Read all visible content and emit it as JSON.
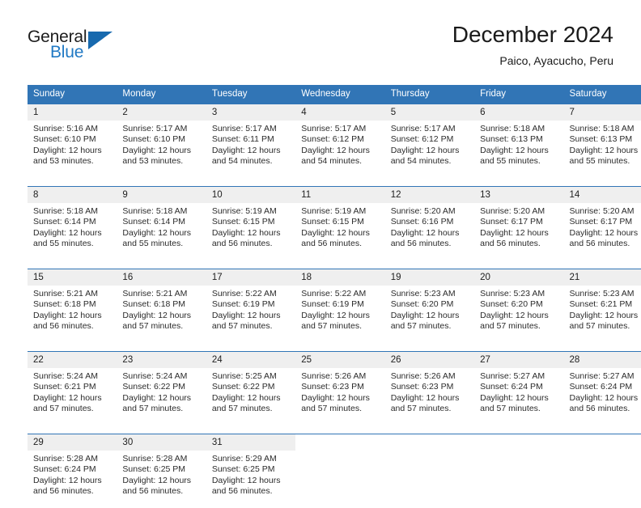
{
  "brand": {
    "name_part1": "General",
    "name_part2": "Blue",
    "triangle_color": "#1769ae",
    "blue_color": "#2079c4"
  },
  "header": {
    "title": "December 2024",
    "subtitle": "Paico, Ayacucho, Peru"
  },
  "theme": {
    "header_blue": "#3175b6",
    "daynum_bg": "#efefef"
  },
  "weekdays": [
    "Sunday",
    "Monday",
    "Tuesday",
    "Wednesday",
    "Thursday",
    "Friday",
    "Saturday"
  ],
  "labels": {
    "sunrise_prefix": "Sunrise:",
    "sunset_prefix": "Sunset:",
    "daylight_prefix": "Daylight:"
  },
  "weeks": [
    [
      {
        "day": "1",
        "sunrise": "Sunrise: 5:16 AM",
        "sunset": "Sunset: 6:10 PM",
        "daylight1": "Daylight: 12 hours",
        "daylight2": "and 53 minutes."
      },
      {
        "day": "2",
        "sunrise": "Sunrise: 5:17 AM",
        "sunset": "Sunset: 6:10 PM",
        "daylight1": "Daylight: 12 hours",
        "daylight2": "and 53 minutes."
      },
      {
        "day": "3",
        "sunrise": "Sunrise: 5:17 AM",
        "sunset": "Sunset: 6:11 PM",
        "daylight1": "Daylight: 12 hours",
        "daylight2": "and 54 minutes."
      },
      {
        "day": "4",
        "sunrise": "Sunrise: 5:17 AM",
        "sunset": "Sunset: 6:12 PM",
        "daylight1": "Daylight: 12 hours",
        "daylight2": "and 54 minutes."
      },
      {
        "day": "5",
        "sunrise": "Sunrise: 5:17 AM",
        "sunset": "Sunset: 6:12 PM",
        "daylight1": "Daylight: 12 hours",
        "daylight2": "and 54 minutes."
      },
      {
        "day": "6",
        "sunrise": "Sunrise: 5:18 AM",
        "sunset": "Sunset: 6:13 PM",
        "daylight1": "Daylight: 12 hours",
        "daylight2": "and 55 minutes."
      },
      {
        "day": "7",
        "sunrise": "Sunrise: 5:18 AM",
        "sunset": "Sunset: 6:13 PM",
        "daylight1": "Daylight: 12 hours",
        "daylight2": "and 55 minutes."
      }
    ],
    [
      {
        "day": "8",
        "sunrise": "Sunrise: 5:18 AM",
        "sunset": "Sunset: 6:14 PM",
        "daylight1": "Daylight: 12 hours",
        "daylight2": "and 55 minutes."
      },
      {
        "day": "9",
        "sunrise": "Sunrise: 5:18 AM",
        "sunset": "Sunset: 6:14 PM",
        "daylight1": "Daylight: 12 hours",
        "daylight2": "and 55 minutes."
      },
      {
        "day": "10",
        "sunrise": "Sunrise: 5:19 AM",
        "sunset": "Sunset: 6:15 PM",
        "daylight1": "Daylight: 12 hours",
        "daylight2": "and 56 minutes."
      },
      {
        "day": "11",
        "sunrise": "Sunrise: 5:19 AM",
        "sunset": "Sunset: 6:15 PM",
        "daylight1": "Daylight: 12 hours",
        "daylight2": "and 56 minutes."
      },
      {
        "day": "12",
        "sunrise": "Sunrise: 5:20 AM",
        "sunset": "Sunset: 6:16 PM",
        "daylight1": "Daylight: 12 hours",
        "daylight2": "and 56 minutes."
      },
      {
        "day": "13",
        "sunrise": "Sunrise: 5:20 AM",
        "sunset": "Sunset: 6:17 PM",
        "daylight1": "Daylight: 12 hours",
        "daylight2": "and 56 minutes."
      },
      {
        "day": "14",
        "sunrise": "Sunrise: 5:20 AM",
        "sunset": "Sunset: 6:17 PM",
        "daylight1": "Daylight: 12 hours",
        "daylight2": "and 56 minutes."
      }
    ],
    [
      {
        "day": "15",
        "sunrise": "Sunrise: 5:21 AM",
        "sunset": "Sunset: 6:18 PM",
        "daylight1": "Daylight: 12 hours",
        "daylight2": "and 56 minutes."
      },
      {
        "day": "16",
        "sunrise": "Sunrise: 5:21 AM",
        "sunset": "Sunset: 6:18 PM",
        "daylight1": "Daylight: 12 hours",
        "daylight2": "and 57 minutes."
      },
      {
        "day": "17",
        "sunrise": "Sunrise: 5:22 AM",
        "sunset": "Sunset: 6:19 PM",
        "daylight1": "Daylight: 12 hours",
        "daylight2": "and 57 minutes."
      },
      {
        "day": "18",
        "sunrise": "Sunrise: 5:22 AM",
        "sunset": "Sunset: 6:19 PM",
        "daylight1": "Daylight: 12 hours",
        "daylight2": "and 57 minutes."
      },
      {
        "day": "19",
        "sunrise": "Sunrise: 5:23 AM",
        "sunset": "Sunset: 6:20 PM",
        "daylight1": "Daylight: 12 hours",
        "daylight2": "and 57 minutes."
      },
      {
        "day": "20",
        "sunrise": "Sunrise: 5:23 AM",
        "sunset": "Sunset: 6:20 PM",
        "daylight1": "Daylight: 12 hours",
        "daylight2": "and 57 minutes."
      },
      {
        "day": "21",
        "sunrise": "Sunrise: 5:23 AM",
        "sunset": "Sunset: 6:21 PM",
        "daylight1": "Daylight: 12 hours",
        "daylight2": "and 57 minutes."
      }
    ],
    [
      {
        "day": "22",
        "sunrise": "Sunrise: 5:24 AM",
        "sunset": "Sunset: 6:21 PM",
        "daylight1": "Daylight: 12 hours",
        "daylight2": "and 57 minutes."
      },
      {
        "day": "23",
        "sunrise": "Sunrise: 5:24 AM",
        "sunset": "Sunset: 6:22 PM",
        "daylight1": "Daylight: 12 hours",
        "daylight2": "and 57 minutes."
      },
      {
        "day": "24",
        "sunrise": "Sunrise: 5:25 AM",
        "sunset": "Sunset: 6:22 PM",
        "daylight1": "Daylight: 12 hours",
        "daylight2": "and 57 minutes."
      },
      {
        "day": "25",
        "sunrise": "Sunrise: 5:26 AM",
        "sunset": "Sunset: 6:23 PM",
        "daylight1": "Daylight: 12 hours",
        "daylight2": "and 57 minutes."
      },
      {
        "day": "26",
        "sunrise": "Sunrise: 5:26 AM",
        "sunset": "Sunset: 6:23 PM",
        "daylight1": "Daylight: 12 hours",
        "daylight2": "and 57 minutes."
      },
      {
        "day": "27",
        "sunrise": "Sunrise: 5:27 AM",
        "sunset": "Sunset: 6:24 PM",
        "daylight1": "Daylight: 12 hours",
        "daylight2": "and 57 minutes."
      },
      {
        "day": "28",
        "sunrise": "Sunrise: 5:27 AM",
        "sunset": "Sunset: 6:24 PM",
        "daylight1": "Daylight: 12 hours",
        "daylight2": "and 56 minutes."
      }
    ],
    [
      {
        "day": "29",
        "sunrise": "Sunrise: 5:28 AM",
        "sunset": "Sunset: 6:24 PM",
        "daylight1": "Daylight: 12 hours",
        "daylight2": "and 56 minutes."
      },
      {
        "day": "30",
        "sunrise": "Sunrise: 5:28 AM",
        "sunset": "Sunset: 6:25 PM",
        "daylight1": "Daylight: 12 hours",
        "daylight2": "and 56 minutes."
      },
      {
        "day": "31",
        "sunrise": "Sunrise: 5:29 AM",
        "sunset": "Sunset: 6:25 PM",
        "daylight1": "Daylight: 12 hours",
        "daylight2": "and 56 minutes."
      },
      {
        "day": "",
        "sunrise": "",
        "sunset": "",
        "daylight1": "",
        "daylight2": ""
      },
      {
        "day": "",
        "sunrise": "",
        "sunset": "",
        "daylight1": "",
        "daylight2": ""
      },
      {
        "day": "",
        "sunrise": "",
        "sunset": "",
        "daylight1": "",
        "daylight2": ""
      },
      {
        "day": "",
        "sunrise": "",
        "sunset": "",
        "daylight1": "",
        "daylight2": ""
      }
    ]
  ]
}
